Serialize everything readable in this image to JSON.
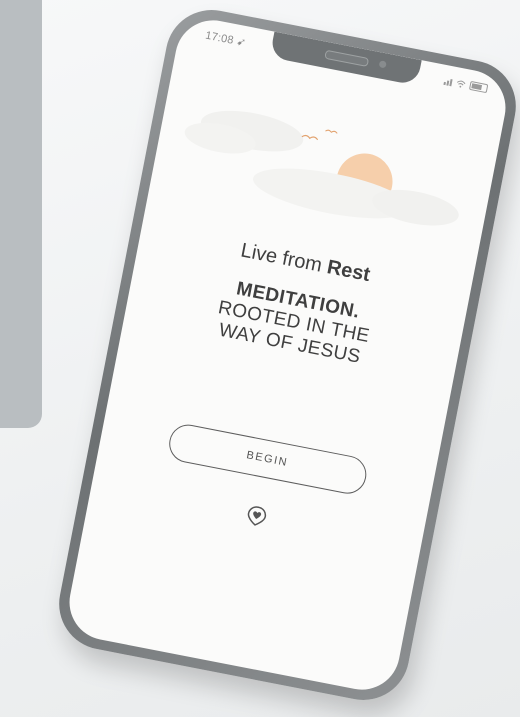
{
  "status_bar": {
    "time": "17:08",
    "location_glyph": "➹",
    "icons": [
      "signal-icon",
      "wifi-icon",
      "battery-icon"
    ]
  },
  "hero": {
    "illustration": "sun-clouds-birds",
    "sun_color": "#f4c79c",
    "cloud_color": "#f1f1ef"
  },
  "tagline": {
    "prefix": "Live from",
    "emphasis": "Rest"
  },
  "title": {
    "bold_line": "MEDITATION.",
    "lines": [
      "ROOTED IN THE",
      "WAY OF JESUS"
    ]
  },
  "begin_button": {
    "label": "BEGIN"
  },
  "logo": {
    "icon": "heart-pin-icon"
  },
  "colors": {
    "side_panel": "#b9bec1",
    "phone_frame": "#6d7173",
    "screen": "#fbfbfa",
    "text": "#3f3f3f"
  }
}
